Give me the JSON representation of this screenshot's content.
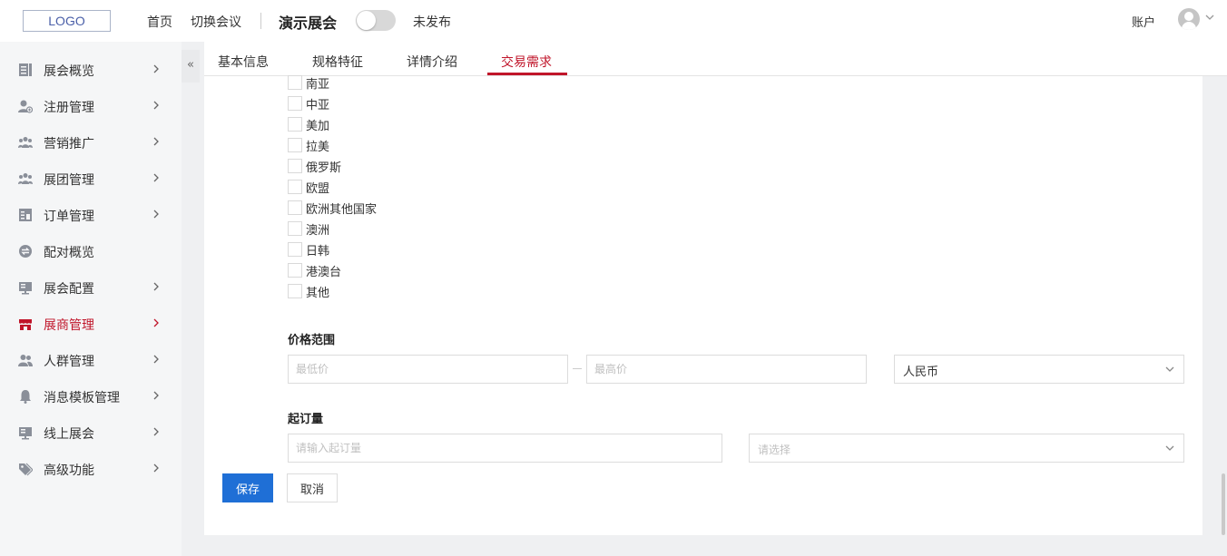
{
  "header": {
    "logo": "LOGO",
    "nav_home": "首页",
    "nav_switch": "切换会议",
    "conference_title": "演示展会",
    "publish_status": "未发布",
    "account_label": "账户"
  },
  "sidebar": {
    "collapse_label": "«",
    "items": [
      {
        "label": "展会概览",
        "icon": "document-list-icon"
      },
      {
        "label": "注册管理",
        "icon": "user-add-icon"
      },
      {
        "label": "营销推广",
        "icon": "users-icon"
      },
      {
        "label": "展团管理",
        "icon": "group-icon"
      },
      {
        "label": "订单管理",
        "icon": "order-icon"
      },
      {
        "label": "配对概览",
        "icon": "exchange-icon"
      },
      {
        "label": "展会配置",
        "icon": "monitor-icon"
      },
      {
        "label": "展商管理",
        "icon": "storefront-icon",
        "active": true
      },
      {
        "label": "人群管理",
        "icon": "people-icon"
      },
      {
        "label": "消息模板管理",
        "icon": "bell-icon"
      },
      {
        "label": "线上展会",
        "icon": "screen-icon"
      },
      {
        "label": "高级功能",
        "icon": "tag-icon"
      }
    ]
  },
  "tabs": [
    {
      "label": "基本信息"
    },
    {
      "label": "规格特征"
    },
    {
      "label": "详情介绍"
    },
    {
      "label": "交易需求",
      "active": true
    }
  ],
  "regions": [
    "南亚",
    "中亚",
    "美加",
    "拉美",
    "俄罗斯",
    "欧盟",
    "欧洲其他国家",
    "澳洲",
    "日韩",
    "港澳台",
    "其他"
  ],
  "price_range": {
    "title": "价格范围",
    "min_placeholder": "最低价",
    "max_placeholder": "最高价",
    "currency": "人民币"
  },
  "moq": {
    "title": "起订量",
    "input_placeholder": "请输入起订量",
    "unit_placeholder": "请选择"
  },
  "actions": {
    "save": "保存",
    "cancel": "取消"
  },
  "colors": {
    "accent": "#c0152a",
    "primary_button": "#1f6fd6",
    "sidebar_bg": "#f5f6f7"
  }
}
